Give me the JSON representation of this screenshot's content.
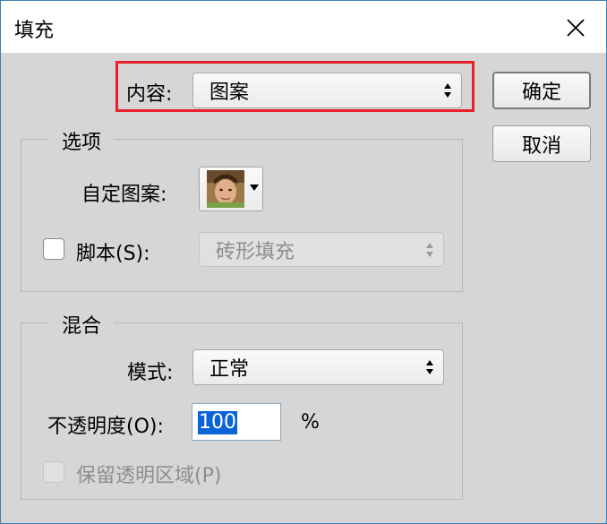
{
  "window": {
    "title": "填充"
  },
  "content": {
    "label": "内容:",
    "value": "图案"
  },
  "buttons": {
    "ok": "确定",
    "cancel": "取消"
  },
  "options": {
    "title": "选项",
    "custom_pattern_label": "自定图案:",
    "script_label": "脚本(S):",
    "script_checked": false,
    "script_value": "砖形填充"
  },
  "blend": {
    "title": "混合",
    "mode_label": "模式:",
    "mode_value": "正常",
    "opacity_label": "不透明度(O):",
    "opacity_value": "100",
    "opacity_unit": "%",
    "preserve_label": "保留透明区域(P)",
    "preserve_checked": false
  },
  "colors": {
    "highlight": "#e8202b",
    "selection": "#0a64d8"
  }
}
